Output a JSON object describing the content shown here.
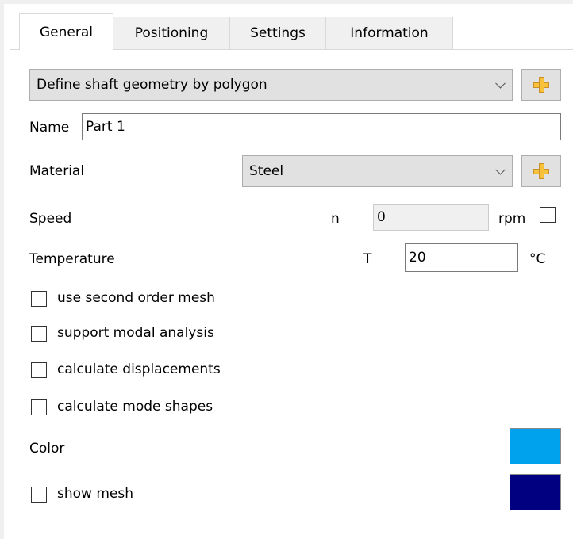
{
  "tabs": [
    {
      "label": "General",
      "active": true
    },
    {
      "label": "Positioning",
      "active": false
    },
    {
      "label": "Settings",
      "active": false
    },
    {
      "label": "Information",
      "active": false
    }
  ],
  "geometry": {
    "selected": "Define shaft geometry by polygon"
  },
  "name": {
    "label": "Name",
    "value": "Part 1"
  },
  "material": {
    "label": "Material",
    "selected": "Steel"
  },
  "speed": {
    "label": "Speed",
    "symbol": "n",
    "value": "0",
    "unit": "rpm",
    "checked": false
  },
  "temperature": {
    "label": "Temperature",
    "symbol": "T",
    "value": "20",
    "unit": "°C"
  },
  "options": [
    {
      "label": "use second order mesh",
      "checked": false
    },
    {
      "label": "support modal analysis",
      "checked": false
    },
    {
      "label": "calculate displacements",
      "checked": false
    },
    {
      "label": "calculate mode shapes",
      "checked": false
    }
  ],
  "color": {
    "label": "Color",
    "value": "#00a2ed"
  },
  "show_mesh": {
    "label": "show mesh",
    "checked": false,
    "color": "#000080"
  }
}
